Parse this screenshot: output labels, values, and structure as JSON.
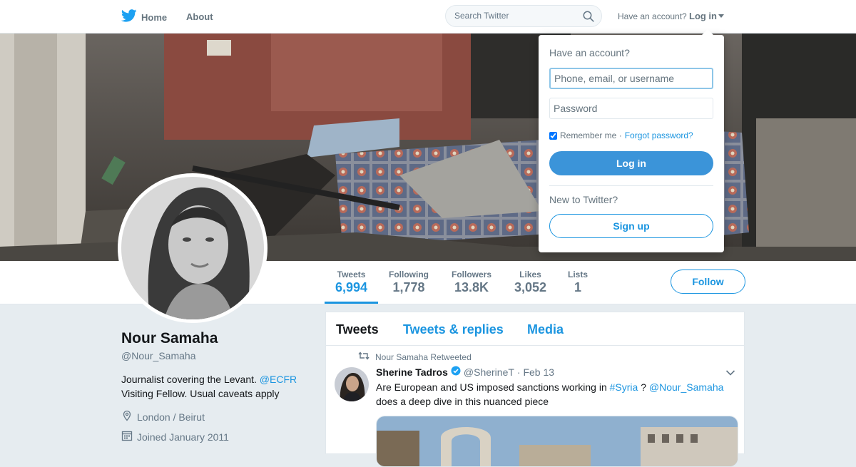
{
  "nav": {
    "home_label": "Home",
    "about_label": "About",
    "search_placeholder": "Search Twitter",
    "have_account": "Have an account?",
    "login_label": "Log in"
  },
  "profile": {
    "name": "Nour Samaha",
    "handle": "@Nour_Samaha",
    "bio_text": "Journalist covering the Levant.",
    "bio_mention": "@ECFR",
    "bio_text_2": "Visiting Fellow. Usual caveats apply",
    "location": "London / Beirut",
    "joined": "Joined January 2011"
  },
  "stats": [
    {
      "label": "Tweets",
      "value": "6,994"
    },
    {
      "label": "Following",
      "value": "1,778"
    },
    {
      "label": "Followers",
      "value": "13.8K"
    },
    {
      "label": "Likes",
      "value": "3,052"
    },
    {
      "label": "Lists",
      "value": "1"
    }
  ],
  "follow_label": "Follow",
  "timeline": {
    "tabs": [
      "Tweets",
      "Tweets & replies",
      "Media"
    ],
    "tweet": {
      "retweet_context": "Nour Samaha Retweeted",
      "author_name": "Sherine Tadros",
      "author_handle": "@SherineT",
      "date": "· Feb 13",
      "text_1": "Are European and US imposed sanctions working in",
      "hashtag": "#Syria",
      "text_2": "?",
      "mention": "@Nour_Samaha",
      "text_3": "does a deep dive in this nuanced piece"
    }
  },
  "login_dropdown": {
    "title": "Have an account?",
    "username_placeholder": "Phone, email, or username",
    "password_placeholder": "Password",
    "remember_label": "Remember me ·",
    "forgot_label": "Forgot password?",
    "login_button": "Log in",
    "new_to_twitter": "New to Twitter?",
    "signup_button": "Sign up"
  },
  "colors": {
    "accent": "#1b95e0",
    "login_button_bg": "#3b94d9",
    "page_bg": "#e6ecf0"
  }
}
